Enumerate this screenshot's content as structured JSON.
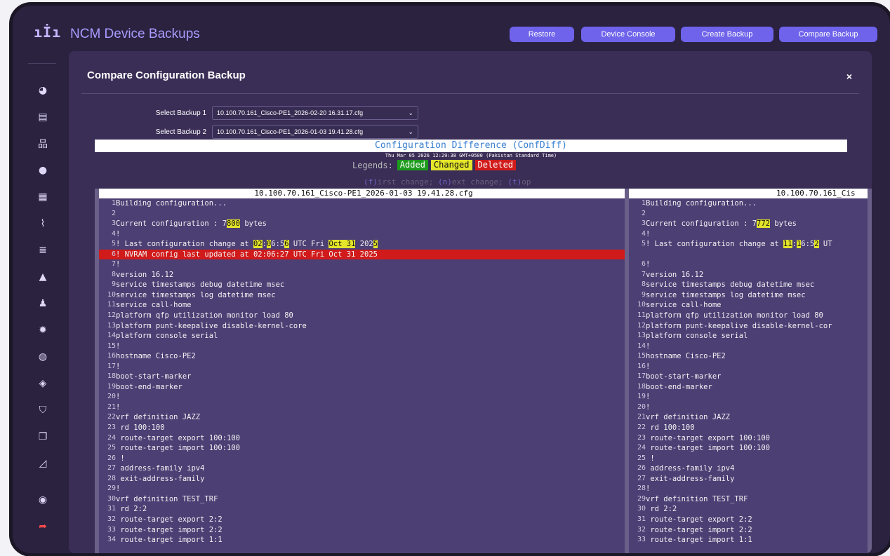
{
  "sidebar": {
    "logo": "ıİı",
    "icons": [
      "dashboard-icon",
      "document-icon",
      "network-icon",
      "wrench-icon",
      "table-icon",
      "chart-icon",
      "database-icon",
      "warning-icon",
      "user-icon",
      "gear-icon",
      "globe-icon",
      "cube-icon",
      "shield-icon",
      "copy-icon",
      "graph-icon",
      "profile-icon",
      "logout-icon"
    ]
  },
  "topbar": {
    "title": "NCM Device Backups",
    "buttons": [
      "Restore",
      "Device Console",
      "Create Backup",
      "Compare Backup"
    ]
  },
  "modal": {
    "title": "Compare Configuration Backup",
    "close": "×",
    "select1_label": "Select Backup 1",
    "select1_value": "10.100.70.161_Cisco-PE1_2026-02-20 16.31.17.cfg",
    "select2_label": "Select Backup 2",
    "select2_value": "10.100.70.161_Cisco-PE1_2026-01-03 19.41.28.cfg"
  },
  "diff": {
    "title": "Configuration Difference (ConfDiff)",
    "date": "Thu Mar 05 2026 12:29:38 GMT+0500 (Pakistan Standard Time)",
    "legends_label": "Legends:",
    "legend_added": "Added",
    "legend_changed": "Changed",
    "legend_deleted": "Deleted",
    "nav_f": "(f)",
    "nav_f_text": "irst change;",
    "nav_n": "(n)",
    "nav_n_text": "ext change;",
    "nav_t": "(t)",
    "nav_t_text": "op",
    "left_file": "10.100.70.161_Cisco-PE1_2026-01-03 19.41.28.cfg",
    "right_file": "10.100.70.161_Cis"
  },
  "left_lines": [
    {
      "n": "1",
      "t": "Building configuration..."
    },
    {
      "n": "2",
      "t": ""
    },
    {
      "n": "3",
      "t": "Current configuration : 7",
      "h": "800",
      "r": " bytes"
    },
    {
      "n": "4",
      "t": "!"
    },
    {
      "n": "5",
      "t": "! Last configuration change at ",
      "h": "02",
      "r": ":",
      "h2": "0",
      "r2": "6:5",
      "h3": "6",
      "r3": " UTC Fri ",
      "h4": "Oct 31",
      "r4": " 202",
      "h5": "5"
    },
    {
      "n": "6",
      "t": "! NVRAM config last updated at 02:06:27 UTC Fri Oct 31 2025",
      "del": true
    },
    {
      "n": "7",
      "t": "!"
    },
    {
      "n": "8",
      "t": "version 16.12"
    },
    {
      "n": "9",
      "t": "service timestamps debug datetime msec"
    },
    {
      "n": "10",
      "t": "service timestamps log datetime msec"
    },
    {
      "n": "11",
      "t": "service call-home"
    },
    {
      "n": "12",
      "t": "platform qfp utilization monitor load 80"
    },
    {
      "n": "13",
      "t": "platform punt-keepalive disable-kernel-core"
    },
    {
      "n": "14",
      "t": "platform console serial"
    },
    {
      "n": "15",
      "t": "!"
    },
    {
      "n": "16",
      "t": "hostname Cisco-PE2"
    },
    {
      "n": "17",
      "t": "!"
    },
    {
      "n": "18",
      "t": "boot-start-marker"
    },
    {
      "n": "19",
      "t": "boot-end-marker"
    },
    {
      "n": "20",
      "t": "!"
    },
    {
      "n": "21",
      "t": "!"
    },
    {
      "n": "22",
      "t": "vrf definition JAZZ"
    },
    {
      "n": "23",
      "t": " rd 100:100"
    },
    {
      "n": "24",
      "t": " route-target export 100:100"
    },
    {
      "n": "25",
      "t": " route-target import 100:100"
    },
    {
      "n": "26",
      "t": " !"
    },
    {
      "n": "27",
      "t": " address-family ipv4"
    },
    {
      "n": "28",
      "t": " exit-address-family"
    },
    {
      "n": "29",
      "t": "!"
    },
    {
      "n": "30",
      "t": "vrf definition TEST_TRF"
    },
    {
      "n": "31",
      "t": " rd 2:2"
    },
    {
      "n": "32",
      "t": " route-target export 2:2"
    },
    {
      "n": "33",
      "t": " route-target import 2:2"
    },
    {
      "n": "34",
      "t": " route-target import 1:1"
    }
  ],
  "right_lines": [
    {
      "n": "1",
      "t": "Building configuration..."
    },
    {
      "n": "2",
      "t": ""
    },
    {
      "n": "3",
      "t": "Current configuration : 7",
      "h": "772",
      "r": " bytes"
    },
    {
      "n": "4",
      "t": "!"
    },
    {
      "n": "5",
      "t": "! Last configuration change at ",
      "h": "11",
      "r": ":",
      "h2": "1",
      "r2": "6:5",
      "h3": "2",
      "r3": " UT"
    },
    {
      "n": "",
      "t": ""
    },
    {
      "n": "6",
      "t": "!"
    },
    {
      "n": "7",
      "t": "version 16.12"
    },
    {
      "n": "8",
      "t": "service timestamps debug datetime msec"
    },
    {
      "n": "9",
      "t": "service timestamps log datetime msec"
    },
    {
      "n": "10",
      "t": "service call-home"
    },
    {
      "n": "11",
      "t": "platform qfp utilization monitor load 80"
    },
    {
      "n": "12",
      "t": "platform punt-keepalive disable-kernel-cor"
    },
    {
      "n": "13",
      "t": "platform console serial"
    },
    {
      "n": "14",
      "t": "!"
    },
    {
      "n": "15",
      "t": "hostname Cisco-PE2"
    },
    {
      "n": "16",
      "t": "!"
    },
    {
      "n": "17",
      "t": "boot-start-marker"
    },
    {
      "n": "18",
      "t": "boot-end-marker"
    },
    {
      "n": "19",
      "t": "!"
    },
    {
      "n": "20",
      "t": "!"
    },
    {
      "n": "21",
      "t": "vrf definition JAZZ"
    },
    {
      "n": "22",
      "t": " rd 100:100"
    },
    {
      "n": "23",
      "t": " route-target export 100:100"
    },
    {
      "n": "24",
      "t": " route-target import 100:100"
    },
    {
      "n": "25",
      "t": " !"
    },
    {
      "n": "26",
      "t": " address-family ipv4"
    },
    {
      "n": "27",
      "t": " exit-address-family"
    },
    {
      "n": "28",
      "t": "!"
    },
    {
      "n": "29",
      "t": "vrf definition TEST_TRF"
    },
    {
      "n": "30",
      "t": " rd 2:2"
    },
    {
      "n": "31",
      "t": " route-target export 2:2"
    },
    {
      "n": "32",
      "t": " route-target import 2:2"
    },
    {
      "n": "33",
      "t": " route-target import 1:1"
    }
  ]
}
